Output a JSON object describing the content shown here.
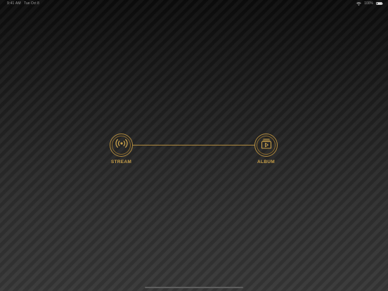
{
  "status_bar": {
    "time": "9:41 AM",
    "date": "Tue Oct 8",
    "battery_percent": "100%"
  },
  "connection": {
    "nodes": [
      {
        "label": "STREAM",
        "icon": "broadcast-icon"
      },
      {
        "label": "ALBUM",
        "icon": "album-play-icon"
      }
    ]
  },
  "colors": {
    "accent": "#c8a04a",
    "line": "#b08a3e",
    "background": "#2b2b2b"
  }
}
